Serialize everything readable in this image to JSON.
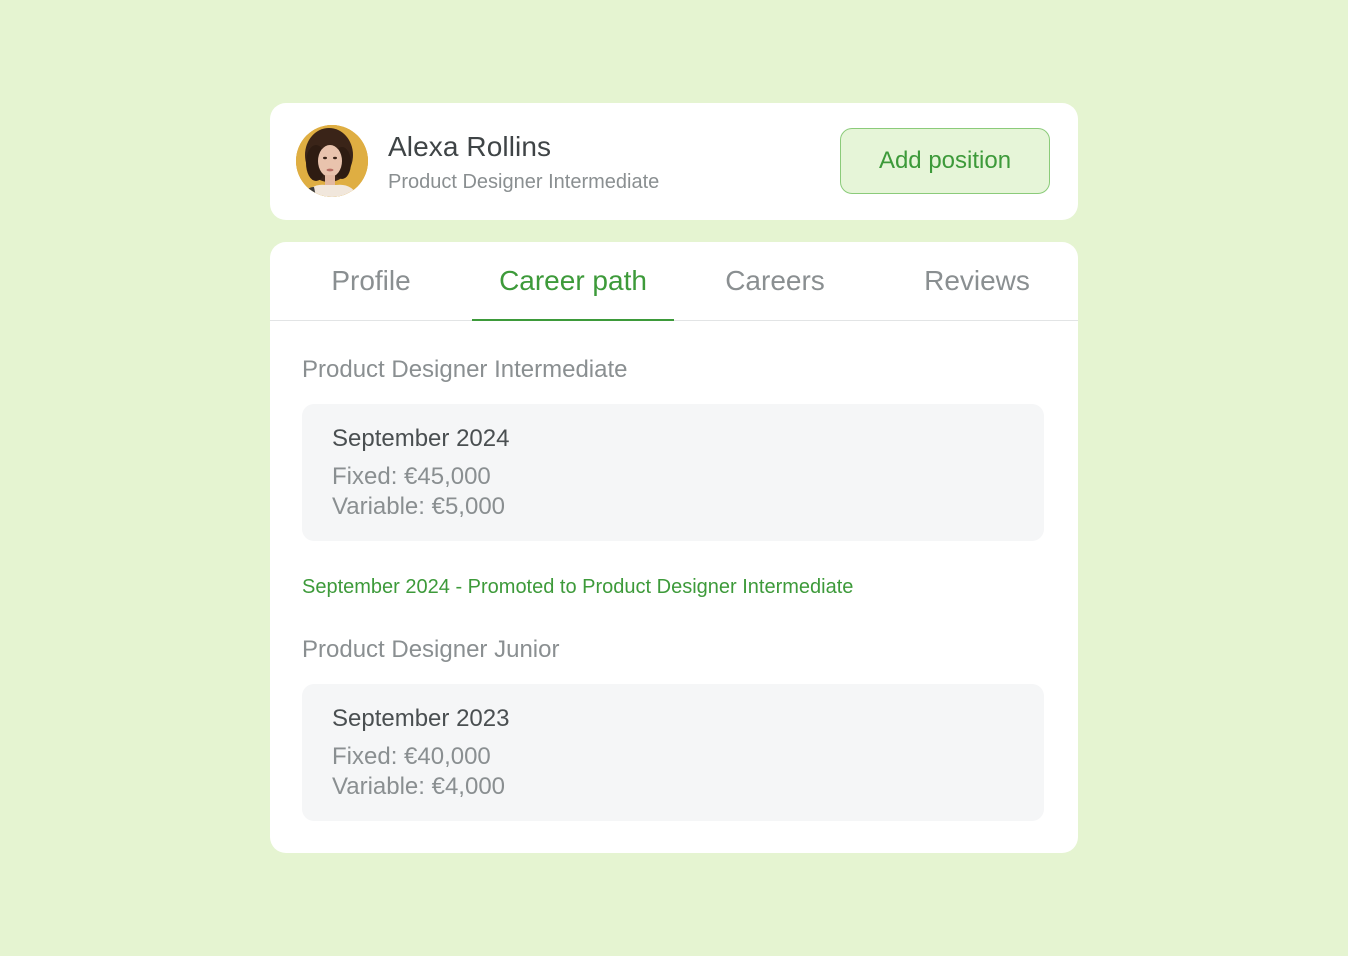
{
  "header": {
    "name": "Alexa Rollins",
    "role": "Product Designer Intermediate",
    "add_button_label": "Add position"
  },
  "tabs": [
    {
      "label": "Profile",
      "active": false
    },
    {
      "label": "Career path",
      "active": true
    },
    {
      "label": "Careers",
      "active": false
    },
    {
      "label": "Reviews",
      "active": false
    }
  ],
  "career": {
    "sections": [
      {
        "title": "Product Designer Intermediate",
        "entry": {
          "date": "September 2024",
          "fixed": "Fixed: €45,000",
          "variable": "Variable: €5,000"
        }
      },
      {
        "title": "Product Designer Junior",
        "entry": {
          "date": "September 2023",
          "fixed": "Fixed: €40,000",
          "variable": "Variable: €4,000"
        }
      }
    ],
    "promotion": "September 2024 - Promoted to Product Designer Intermediate"
  },
  "colors": {
    "background": "#e5f4d1",
    "accent": "#3d9a3a",
    "muted_text": "#8a8f91",
    "entry_background": "#f5f6f7"
  },
  "icons": {
    "avatar": "user-portrait-photo"
  }
}
